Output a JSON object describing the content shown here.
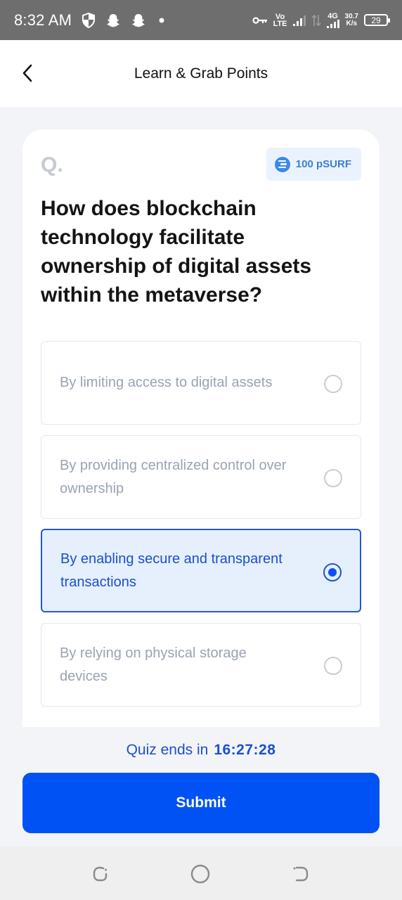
{
  "status_bar": {
    "time": "8:32 AM",
    "network_top": "Vo",
    "network_bottom": "LTE",
    "network_type": "4G",
    "speed_value": "30.7",
    "speed_unit": "K/s",
    "battery": "29",
    "icons": [
      "shield-icon",
      "snapchat-icon",
      "snapchat-icon",
      "dot-icon",
      "vpn-key-icon",
      "signal-icon",
      "data-arrows-icon",
      "signal-4g-icon",
      "battery-icon"
    ]
  },
  "header": {
    "title": "Learn & Grab Points",
    "back_icon": "chevron-left-icon"
  },
  "quiz": {
    "q_label": "Q.",
    "reward": "100 pSURF",
    "reward_icon": "psurf-coin-icon",
    "question": "How does blockchain technology facilitate ownership of digital assets within the metaverse?",
    "options": [
      {
        "label": "By limiting access to digital assets",
        "selected": false
      },
      {
        "label": "By providing centralized control over ownership",
        "selected": false
      },
      {
        "label": "By enabling secure and transparent transactions",
        "selected": true
      },
      {
        "label": "By relying on physical storage devices",
        "selected": false
      }
    ]
  },
  "timer": {
    "label": "Quiz ends in",
    "value": "16:27:28"
  },
  "submit_label": "Submit",
  "colors": {
    "primary": "#0052f5",
    "selected_bg": "#e6effc",
    "selected_text": "#1b4fd1",
    "reward_bg": "#eaf3fd",
    "page_bg": "#f2f4f7"
  },
  "nav_bar": {
    "items": [
      "recent-apps-icon",
      "home-icon",
      "back-icon"
    ]
  }
}
